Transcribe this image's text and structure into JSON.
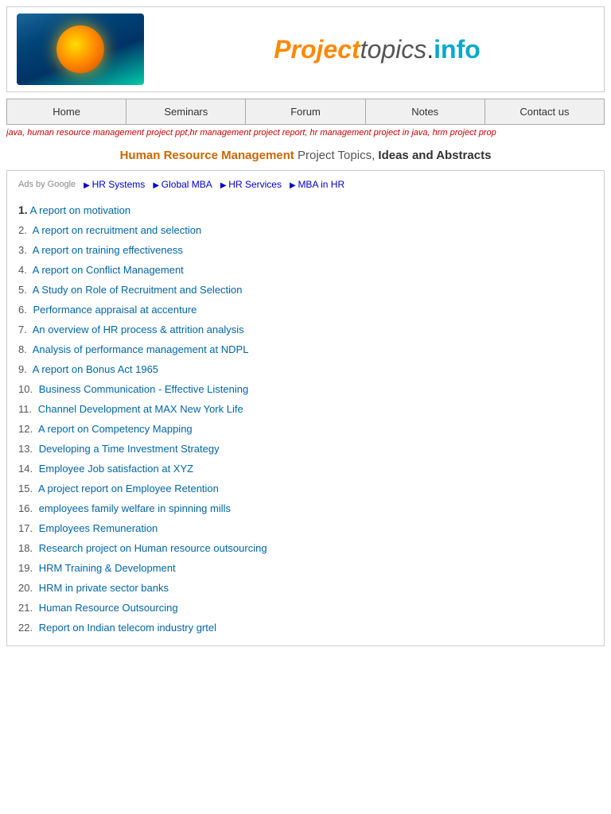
{
  "header": {
    "title_project": "Project",
    "title_topics": "topics",
    "title_dot": ".",
    "title_info": "info"
  },
  "nav": {
    "items": [
      {
        "label": "Home",
        "id": "home"
      },
      {
        "label": "Seminars",
        "id": "seminars"
      },
      {
        "label": "Forum",
        "id": "forum"
      },
      {
        "label": "Notes",
        "id": "notes"
      },
      {
        "label": "Contact us",
        "id": "contact"
      }
    ]
  },
  "tag_strip": "java, human resource management project ppt,hr management project report, hr management project in java, hrm project prop",
  "page_title": {
    "hrm": "Human Resource Management",
    "rest": " Project Topics,",
    "bold": " Ideas and Abstracts"
  },
  "ads": {
    "label": "Ads by Google",
    "links": [
      "HR Systems",
      "Global MBA",
      "HR Services",
      "MBA in HR"
    ]
  },
  "topics": [
    {
      "num": "1.",
      "text": "A report on motivation",
      "main": true
    },
    {
      "num": "2.",
      "text": "A report on recruitment and selection"
    },
    {
      "num": "3.",
      "text": "A report on training effectiveness"
    },
    {
      "num": "4.",
      "text": "A report on Conflict Management"
    },
    {
      "num": "5.",
      "text": "A Study on Role of Recruitment and Selection"
    },
    {
      "num": "6.",
      "text": "Performance appraisal at accenture"
    },
    {
      "num": "7.",
      "text": "An overview of HR process & attrition analysis"
    },
    {
      "num": "8.",
      "text": "Analysis of performance management at NDPL"
    },
    {
      "num": "9.",
      "text": "A report on Bonus Act 1965"
    },
    {
      "num": "10.",
      "text": "Business Communication - Effective Listening"
    },
    {
      "num": "11.",
      "text": "Channel Development at MAX New York Life"
    },
    {
      "num": "12.",
      "text": "A report on Competency Mapping"
    },
    {
      "num": "13.",
      "text": "Developing a Time Investment Strategy"
    },
    {
      "num": "14.",
      "text": "Employee Job satisfaction at XYZ"
    },
    {
      "num": "15.",
      "text": "A project report on Employee Retention"
    },
    {
      "num": "16.",
      "text": "employees family welfare in spinning mills"
    },
    {
      "num": "17.",
      "text": "Employees Remuneration"
    },
    {
      "num": "18.",
      "text": "Research project on Human resource outsourcing"
    },
    {
      "num": "19.",
      "text": "HRM Training & Development"
    },
    {
      "num": "20.",
      "text": "HRM in private sector banks"
    },
    {
      "num": "21.",
      "text": "Human Resource Outsourcing"
    },
    {
      "num": "22.",
      "text": "Report on Indian telecom industry grtel"
    }
  ]
}
